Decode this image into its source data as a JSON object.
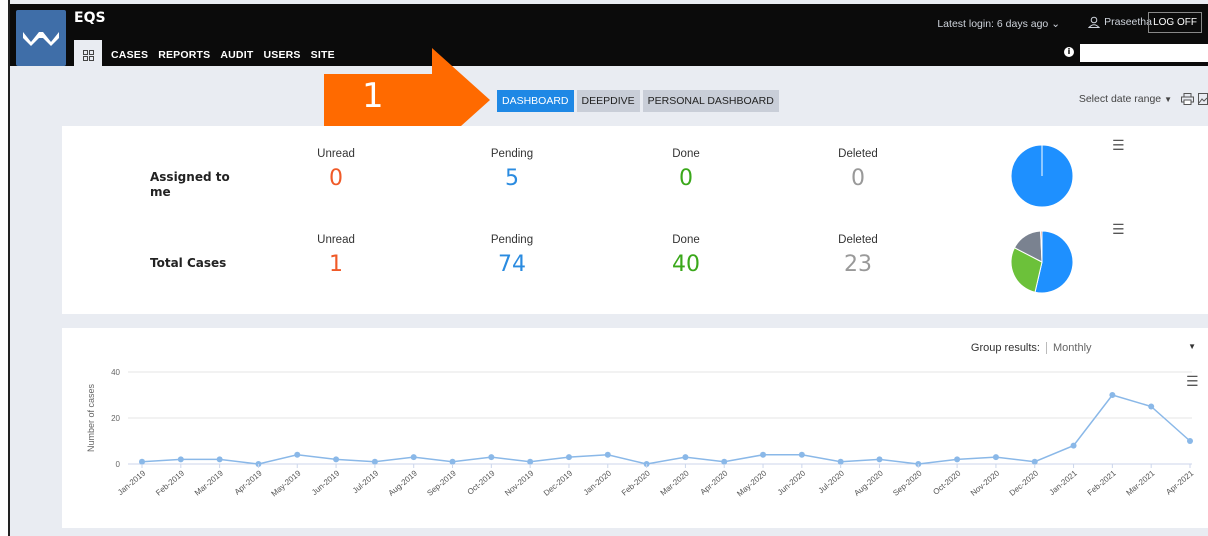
{
  "app": {
    "name": "EQS"
  },
  "nav": [
    {
      "label": "CASES"
    },
    {
      "label": "REPORTS"
    },
    {
      "label": "AUDIT"
    },
    {
      "label": "USERS"
    },
    {
      "label": "SITE"
    }
  ],
  "header": {
    "login_text": "Latest login: 6 days ago",
    "user_name": "Praseetha",
    "logoff_label": "LOG OFF",
    "search_placeholder": ""
  },
  "annotation": {
    "number": "1",
    "color": "#ff6a00"
  },
  "tabs": [
    {
      "label": "DASHBOARD",
      "active": true
    },
    {
      "label": "DEEPDIVE",
      "active": false
    },
    {
      "label": "PERSONAL DASHBOARD",
      "active": false
    }
  ],
  "date_range": {
    "label": "Select date range"
  },
  "assigned": {
    "label_line1": "Assigned to",
    "label_line2": "me",
    "unread_label": "Unread",
    "unread": "0",
    "pending_label": "Pending",
    "pending": "5",
    "done_label": "Done",
    "done": "0",
    "deleted_label": "Deleted",
    "deleted": "0"
  },
  "total": {
    "label": "Total Cases",
    "unread_label": "Unread",
    "unread": "1",
    "pending_label": "Pending",
    "pending": "74",
    "done_label": "Done",
    "done": "40",
    "deleted_label": "Deleted",
    "deleted": "23"
  },
  "colors": {
    "unread": "#f05a28",
    "pending": "#2a8be0",
    "done": "#3aa81a",
    "deleted": "#999999",
    "pie_pending": "#1e90ff",
    "pie_done": "#6cc13a",
    "pie_deleted": "#7a8290",
    "line": "#8ab8e8"
  },
  "group_results": {
    "label": "Group results:",
    "value": "Monthly"
  },
  "chart_data": {
    "type": "line",
    "ylabel": "Number of cases",
    "yticks": [
      "0",
      "20",
      "40"
    ],
    "ylim": [
      0,
      40
    ],
    "categories": [
      "Jan-2019",
      "Feb-2019",
      "Mar-2019",
      "Apr-2019",
      "May-2019",
      "Jun-2019",
      "Jul-2019",
      "Aug-2019",
      "Sep-2019",
      "Oct-2019",
      "Nov-2019",
      "Dec-2019",
      "Jan-2020",
      "Feb-2020",
      "Mar-2020",
      "Apr-2020",
      "May-2020",
      "Jun-2020",
      "Jul-2020",
      "Aug-2020",
      "Sep-2020",
      "Oct-2020",
      "Nov-2020",
      "Dec-2020",
      "Jan-2021",
      "Feb-2021",
      "Mar-2021",
      "Apr-2021"
    ],
    "values": [
      1,
      2,
      2,
      0,
      4,
      2,
      1,
      3,
      1,
      3,
      1,
      3,
      4,
      0,
      3,
      1,
      4,
      4,
      1,
      2,
      0,
      2,
      3,
      1,
      8,
      30,
      25,
      10
    ],
    "grid": true,
    "legend": "none"
  },
  "pies": {
    "assigned": {
      "pending": 5,
      "done": 0,
      "deleted": 0,
      "unread": 0
    },
    "total": {
      "pending": 74,
      "done": 40,
      "deleted": 23,
      "unread": 1
    }
  }
}
